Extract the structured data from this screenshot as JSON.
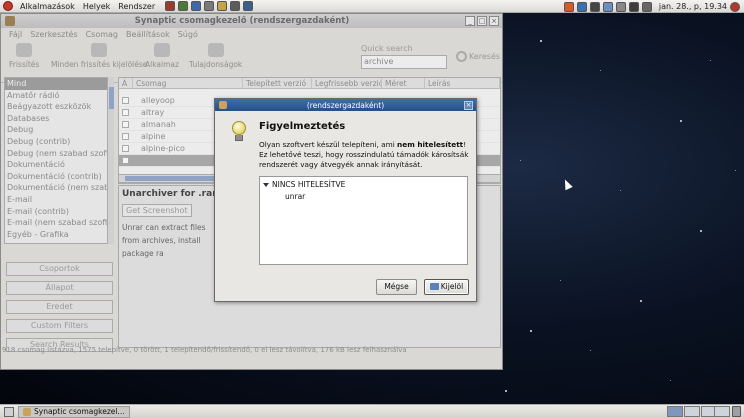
{
  "top_panel": {
    "menus": [
      "Alkalmazások",
      "Helyek",
      "Rendszer"
    ],
    "clock": "jan. 28., p, 19.34"
  },
  "window": {
    "title": "Synaptic csomagkezelő (rendszergazdaként)",
    "menu": [
      "Fájl",
      "Szerkesztés",
      "Csomag",
      "Beállítások",
      "Súgó"
    ],
    "toolbar": {
      "reload": "Frissítés",
      "mark_all": "Minden frissítés kijelölése",
      "apply": "Alkalmaz",
      "properties": "Tulajdonságok",
      "quick_search_label": "Quick search",
      "quick_search_value": "archive",
      "search_button": "Keresés"
    },
    "categories": [
      "Mind",
      "Amatőr rádió",
      "Beágyazott eszközök",
      "Databases",
      "Debug",
      "Debug (contrib)",
      "Debug (nem szabad szoftv",
      "Dokumentáció",
      "Dokumentáció (contrib)",
      "Dokumentáció (nem szabad",
      "E-mail",
      "E-mail (contrib)",
      "E-mail (nem szabad szoftv",
      "Egyéb - Grafika"
    ],
    "side_buttons": [
      "Csoportok",
      "Állapot",
      "Eredet",
      "Custom Filters",
      "Search Results"
    ],
    "columns": [
      "Á",
      "Csomag",
      "Telepített verzió",
      "Legfrissebb verzió",
      "Méret",
      "Leírás"
    ],
    "packages": [
      "alleyoop",
      "altray",
      "almanah",
      "alpine",
      "alpine-pico"
    ],
    "description": {
      "title": "Unarchiver for .rar file",
      "screenshot_button": "Get Screenshot",
      "text": "Unrar can extract files from archives, install package ra"
    },
    "status": "918 csomag listázva, 1575 telepítve, 0 törött, 1 telepítendő/frissítendő, 0 el lesz távolítva, 176 kB lesz felhasználva"
  },
  "dialog": {
    "title": "(rendszergazdaként)",
    "heading": "Figyelmeztetés",
    "msg_part1": "Olyan szoftvert készül telepíteni, ami ",
    "msg_bold": "nem hitelesített",
    "msg_part2": "! Ez lehetővé teszi, hogy rosszindulatú támadók károsítsák rendszerét vagy átvegyék annak irányítását.",
    "tree_root": "NINCS HITELESÍTVE",
    "tree_child": "unrar",
    "cancel_button": "Mégse",
    "ok_button": "Kijelöl"
  },
  "taskbar": {
    "task_label": "Synaptic csomagkezel..."
  }
}
